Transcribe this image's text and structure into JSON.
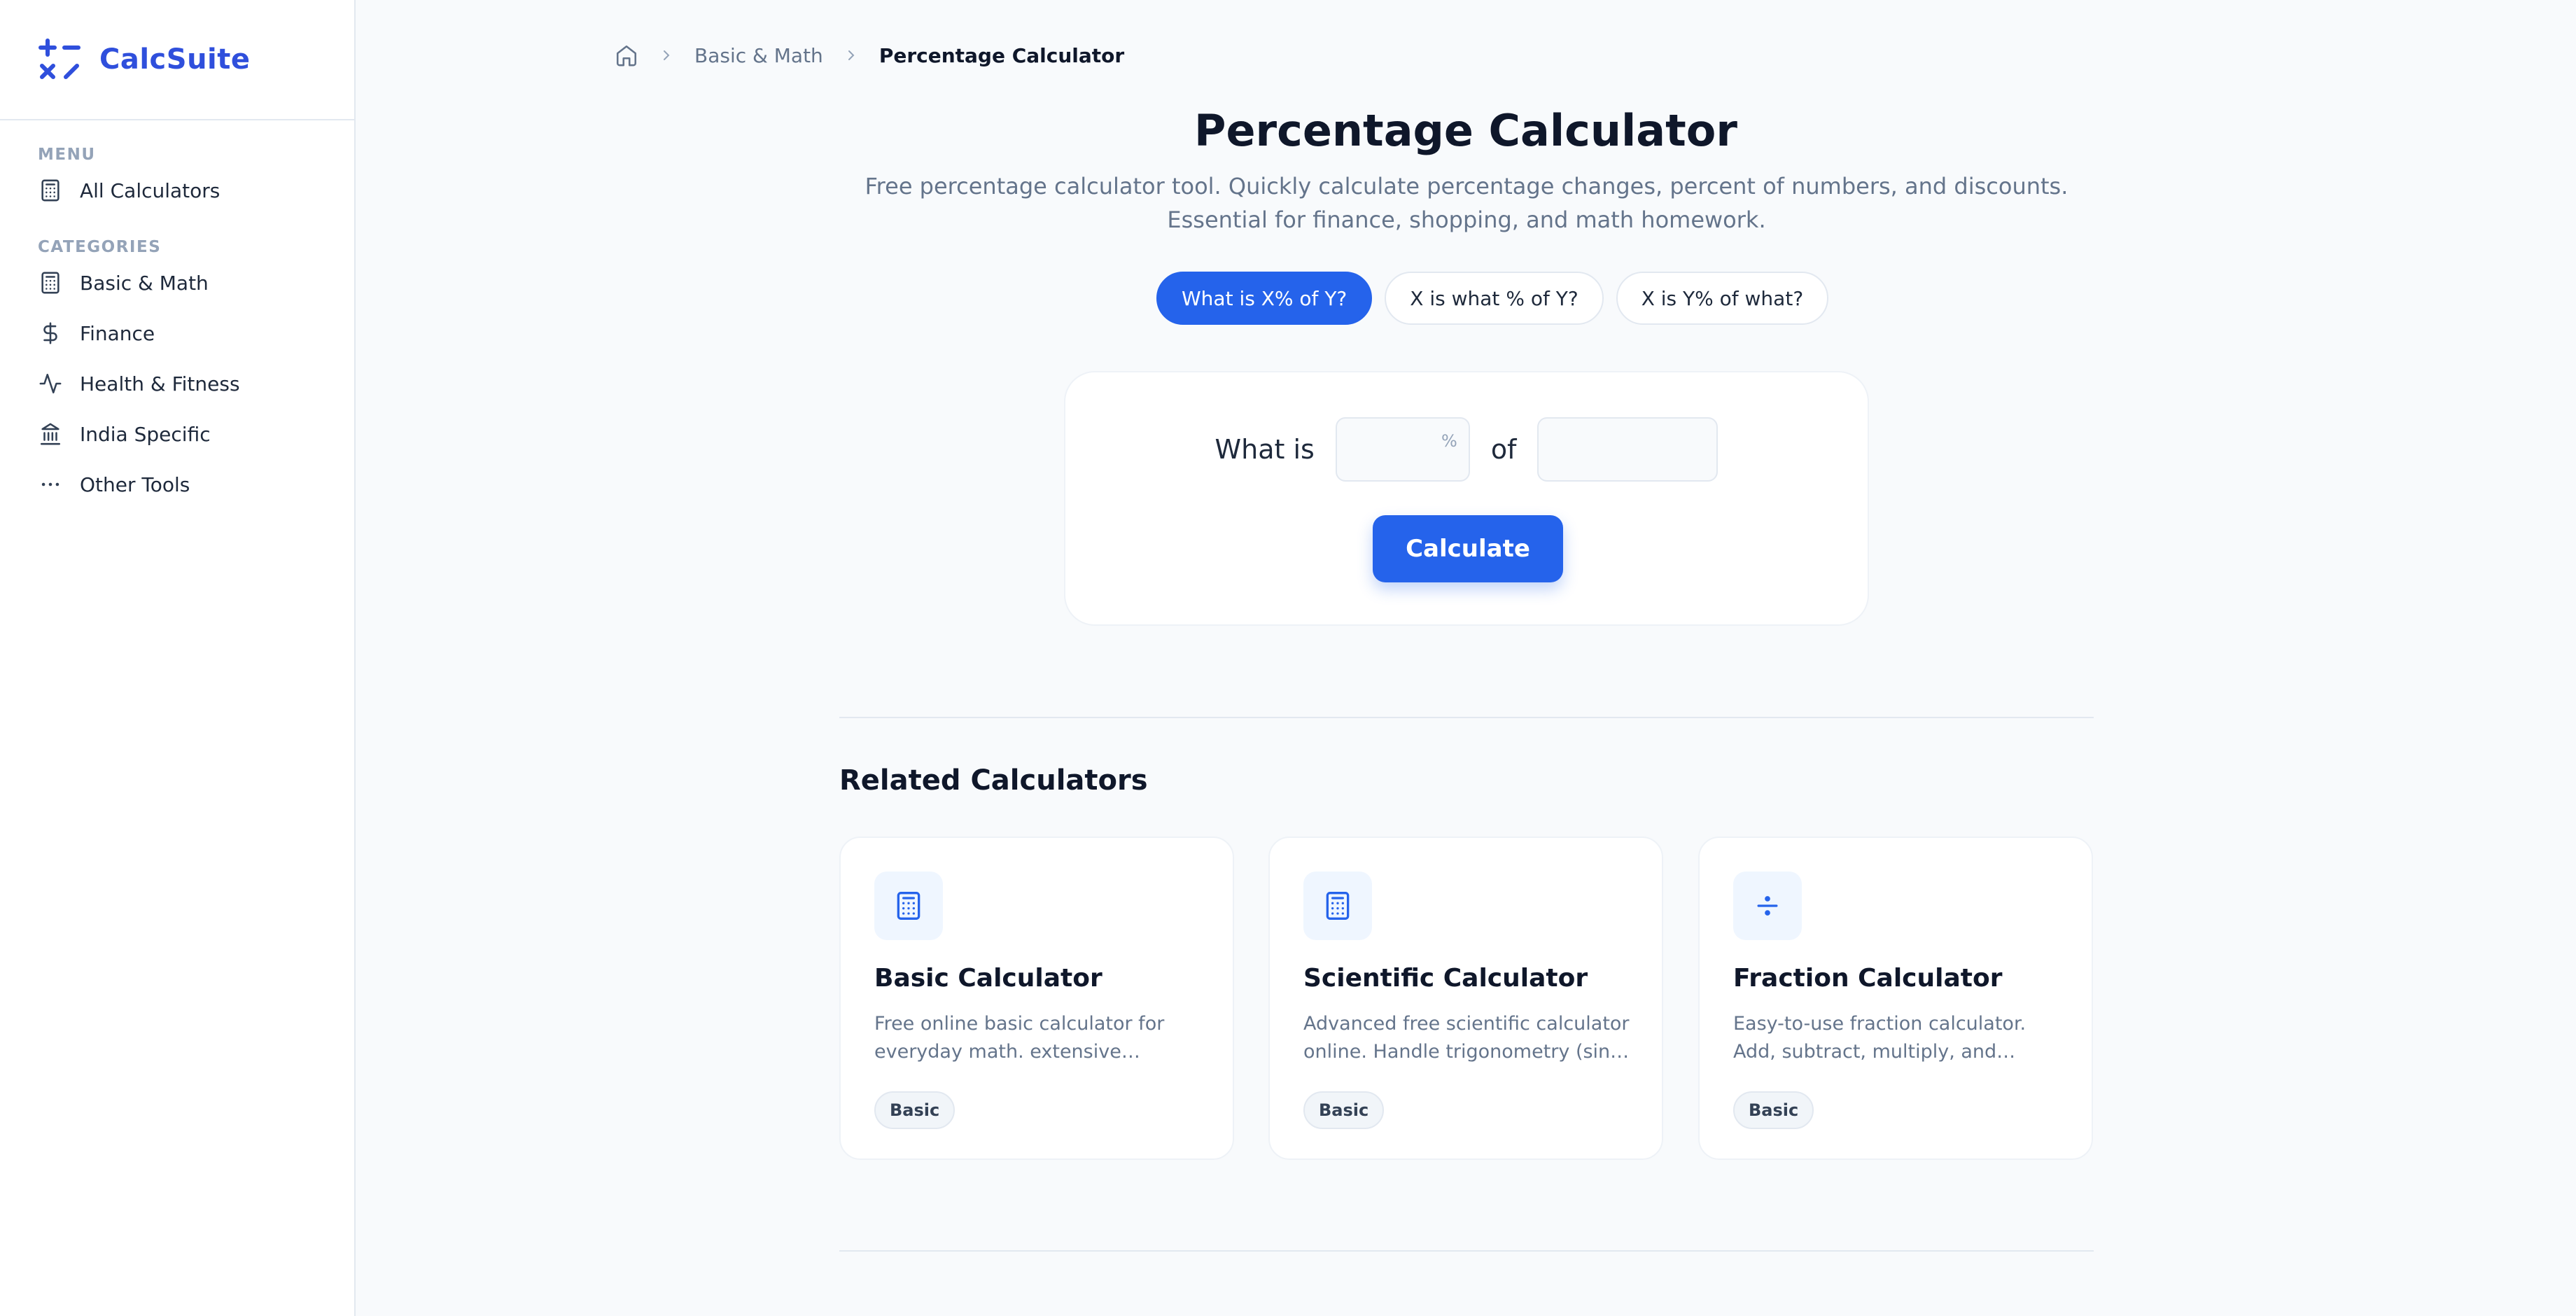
{
  "brand": {
    "name": "CalcSuite",
    "color": "#2f4fdc"
  },
  "sidebar": {
    "menu_heading": "MENU",
    "all_calculators": {
      "label": "All Calculators",
      "icon": "calculator-icon"
    },
    "categories_heading": "CATEGORIES",
    "items": [
      {
        "label": "Basic & Math",
        "icon": "calculator-icon"
      },
      {
        "label": "Finance",
        "icon": "dollar-icon"
      },
      {
        "label": "Health & Fitness",
        "icon": "activity-icon"
      },
      {
        "label": "India Specific",
        "icon": "bank-icon"
      },
      {
        "label": "Other Tools",
        "icon": "more-icon"
      }
    ]
  },
  "breadcrumb": {
    "home_icon": "home-icon",
    "parent": "Basic & Math",
    "current": "Percentage Calculator"
  },
  "page": {
    "title": "Percentage Calculator",
    "subtitle": "Free percentage calculator tool. Quickly calculate percentage changes, percent of numbers, and discounts. Essential for finance, shopping, and math homework."
  },
  "modes": [
    {
      "label": "What is X% of Y?",
      "active": true
    },
    {
      "label": "X is what % of Y?",
      "active": false
    },
    {
      "label": "X is Y% of what?",
      "active": false
    }
  ],
  "calculator": {
    "prefix": "What is",
    "percent_value": "",
    "percent_sign": "%",
    "connector": "of",
    "number_value": "",
    "button_label": "Calculate"
  },
  "related": {
    "heading": "Related Calculators",
    "cards": [
      {
        "title": "Basic Calculator",
        "description": "Free online basic calculator for everyday math. extensive arithmetic operations.",
        "tag": "Basic",
        "icon": "calculator-icon"
      },
      {
        "title": "Scientific Calculator",
        "description": "Advanced free scientific calculator online. Handle trigonometry (sin, cos, tan).",
        "tag": "Basic",
        "icon": "calculator-icon"
      },
      {
        "title": "Fraction Calculator",
        "description": "Easy-to-use fraction calculator. Add, subtract, multiply, and divide fractions.",
        "tag": "Basic",
        "icon": "divide-icon"
      }
    ]
  },
  "colors": {
    "accent": "#2563eb",
    "background": "#f8fafc"
  }
}
